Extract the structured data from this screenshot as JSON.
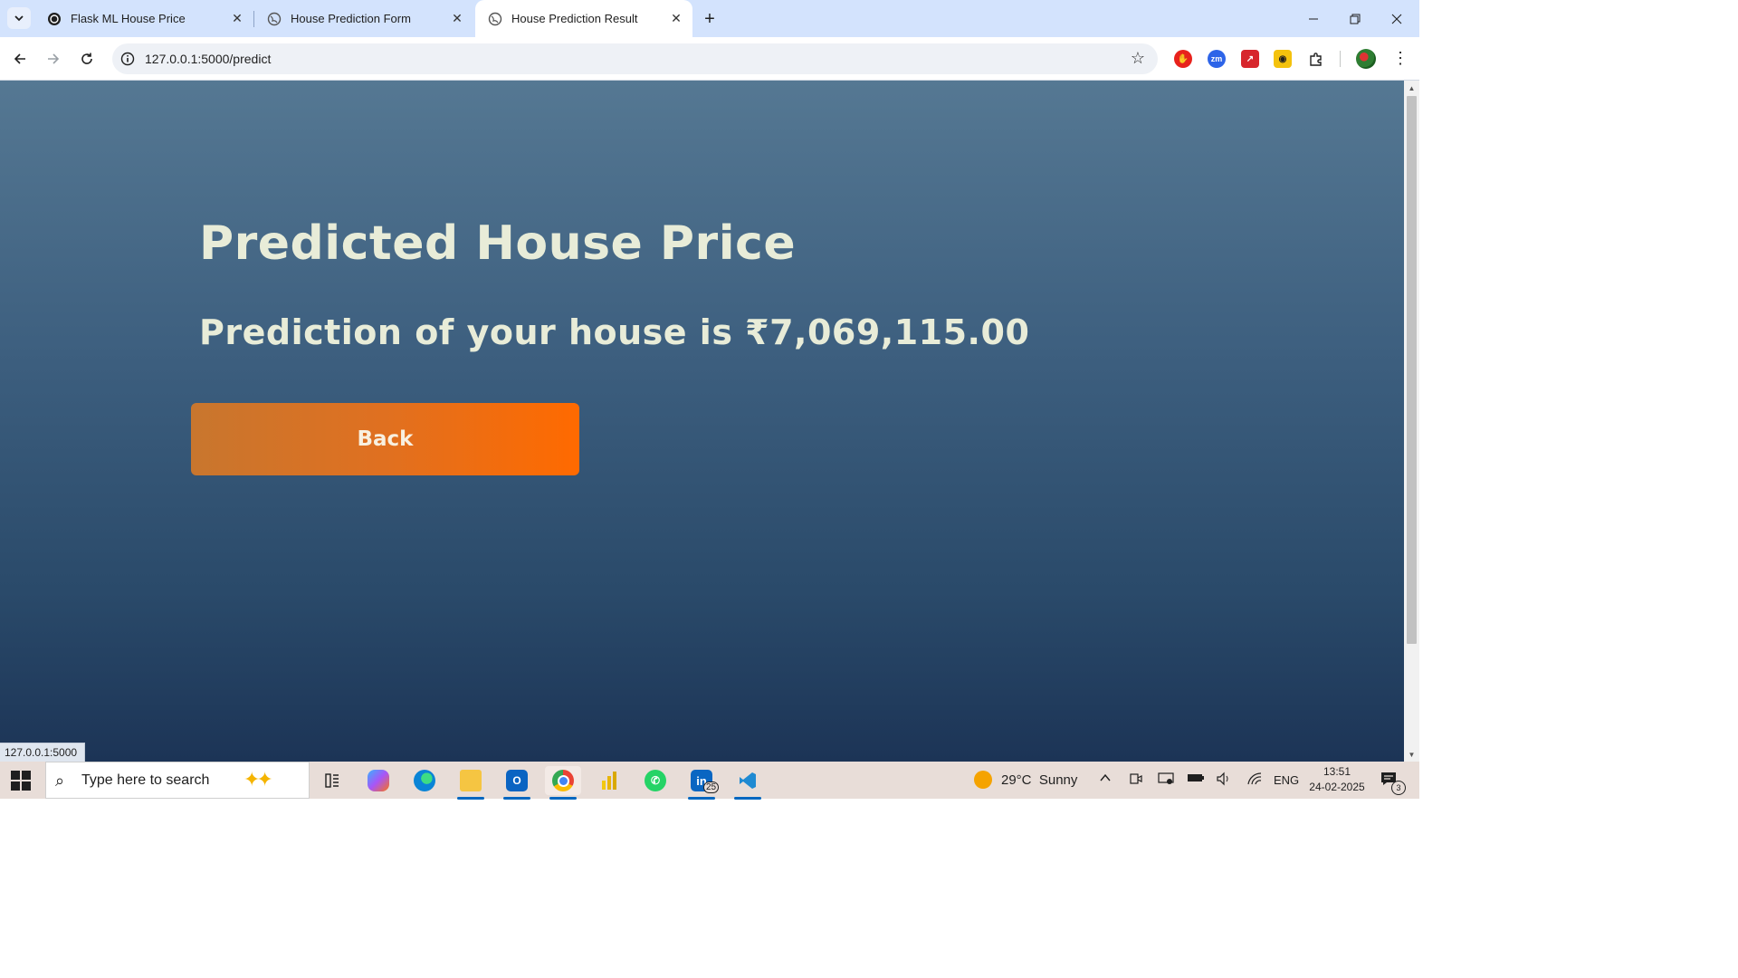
{
  "browser": {
    "tabs": [
      {
        "title": "Flask ML House Price",
        "favicon": "chatgpt-icon",
        "active": false
      },
      {
        "title": "House Prediction Form",
        "favicon": "globe-icon",
        "active": false
      },
      {
        "title": "House Prediction Result",
        "favicon": "globe-icon",
        "active": true
      }
    ],
    "new_tab_label": "+",
    "address": "127.0.0.1:5000/predict",
    "status_url": "127.0.0.1:5000"
  },
  "page": {
    "title": "Predicted House Price",
    "prediction_text": "Prediction of your house is ₹7,069,115.00",
    "back_button": "Back"
  },
  "taskbar": {
    "search_placeholder": "Type here to search",
    "weather": "29°C  Sunny",
    "language": "ENG",
    "time": "13:51",
    "date": "24-02-2025",
    "linkedin_badge": "25",
    "notification_count": "3"
  },
  "colors": {
    "page_gradient_top": "#557893",
    "page_gradient_bottom": "#1c3456",
    "heading_text": "#e8ecd8",
    "button_gradient_start": "#c8762e",
    "button_gradient_end": "#ff6a00",
    "tabstrip": "#d3e3fd",
    "taskbar": "#e8ddd8"
  }
}
